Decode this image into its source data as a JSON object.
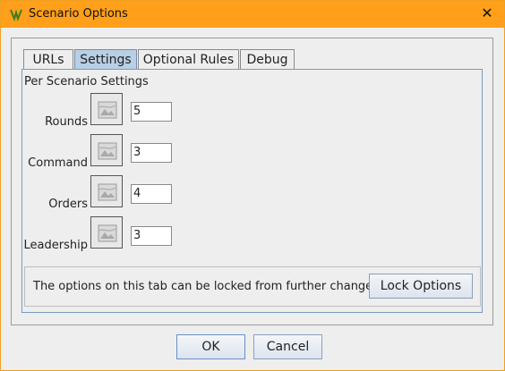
{
  "window": {
    "title": "Scenario Options",
    "close_glyph": "✕"
  },
  "tabs": [
    {
      "label": "URLs",
      "selected": false
    },
    {
      "label": "Settings",
      "selected": true
    },
    {
      "label": "Optional Rules",
      "selected": false
    },
    {
      "label": "Debug",
      "selected": false
    }
  ],
  "section_title": "Per Scenario Settings",
  "settings": [
    {
      "label": "Rounds",
      "value": "5"
    },
    {
      "label": "Command",
      "value": "3"
    },
    {
      "label": "Orders",
      "value": "4"
    },
    {
      "label": "Leadership",
      "value": "3"
    }
  ],
  "lock": {
    "text": "The options on this tab can be locked from further change",
    "button": "Lock Options"
  },
  "footer": {
    "ok": "OK",
    "cancel": "Cancel"
  },
  "colors": {
    "titlebar": "#ff9f1a",
    "selected_tab": "#b8cfe5"
  },
  "icons": {
    "app": "app-logo-icon",
    "close": "close-icon",
    "setting_image": "image-placeholder-icon"
  }
}
